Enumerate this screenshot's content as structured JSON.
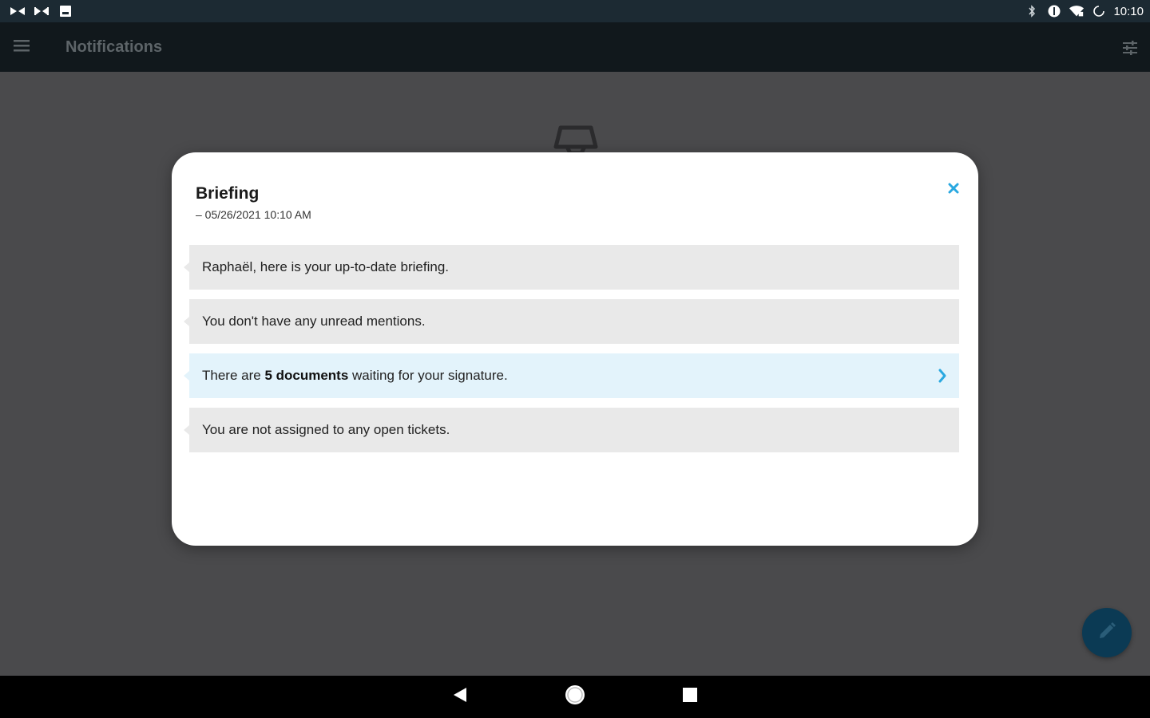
{
  "status_bar": {
    "time": "10:10",
    "left_icons": [
      "media-icon",
      "media-icon",
      "notification-icon"
    ],
    "right_icons": [
      "bluetooth-icon",
      "data-saver-icon",
      "wifi-icon",
      "sync-icon"
    ]
  },
  "app_bar": {
    "title": "Notifications",
    "menu_icon": "hamburger-menu-icon",
    "filter_icon": "filter-settings-icon"
  },
  "dialog": {
    "title": "Briefing",
    "subtitle": "– 05/26/2021 10:10 AM",
    "close_icon": "close-icon",
    "items": [
      {
        "text": "Raphaël, here is your up-to-date briefing."
      },
      {
        "text": "You don't have any unread mentions."
      },
      {
        "text_prefix": "There are ",
        "text_bold": "5 documents",
        "text_suffix": " waiting for your signature.",
        "link": true
      },
      {
        "text": "You are not assigned to any open tickets."
      }
    ]
  },
  "fab": {
    "icon": "edit-pencil-icon"
  },
  "nav_bar": {
    "icons": [
      "back-icon",
      "home-icon",
      "recents-icon"
    ]
  },
  "colors": {
    "accent": "#29a8e0",
    "status_bar": "#1c2a33",
    "app_bar": "#11181c",
    "fab": "#0b3a54",
    "link_item": "#e3f3fb",
    "item": "#e9e9e9"
  }
}
